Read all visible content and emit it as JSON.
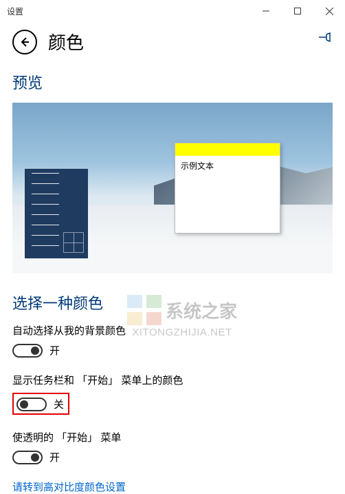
{
  "window": {
    "title": "设置"
  },
  "header": {
    "page_title": "颜色"
  },
  "preview": {
    "heading": "预览",
    "sample_text": "示例文本"
  },
  "color_section": {
    "heading": "选择一种颜色",
    "auto_pick": {
      "label": "自动选择从我的背景颜色",
      "state": "开",
      "on": true
    },
    "show_on_taskbar": {
      "label": "显示任务栏和 「开始」 菜单上的颜色",
      "state": "关",
      "on": false
    },
    "transparent_start": {
      "label": "使透明的 「开始」 菜单",
      "state": "开",
      "on": true
    },
    "high_contrast_link": "请转到高对比度颜色设置"
  },
  "watermark": {
    "brand": "系统之家",
    "url": "XITONGZHIJIA.NET"
  }
}
